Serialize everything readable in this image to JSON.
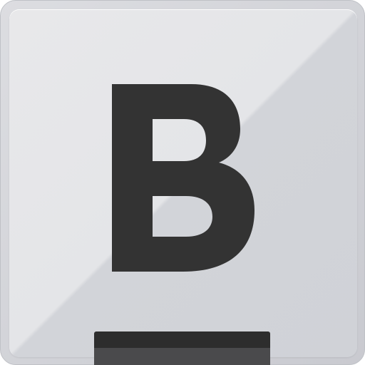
{
  "app_icon": {
    "letter": "B",
    "colors": {
      "glyph": "#333333",
      "face_light": "#e8e8ea",
      "face_dark": "#d0d2d7",
      "frame": "#c9cad0",
      "bar_top": "#2d2d2d",
      "bar_bottom": "#4a4a4c"
    }
  }
}
